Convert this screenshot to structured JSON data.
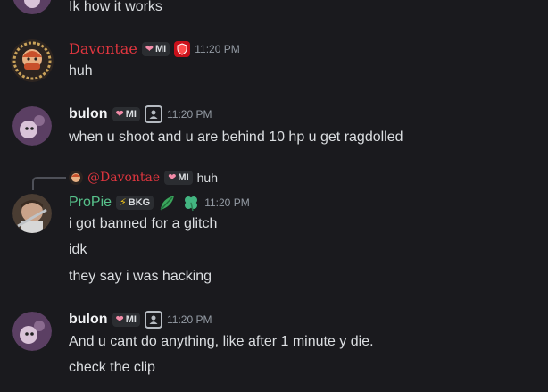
{
  "messages": [
    {
      "text": "Ik how it works"
    },
    {
      "author": "Davontae",
      "tag": "MI",
      "time": "11:20 PM",
      "lines": [
        "huh"
      ]
    },
    {
      "author": "bulon",
      "tag": "MI",
      "time": "11:20 PM",
      "lines": [
        "when u shoot and u are  behind 10 hp u get ragdolled"
      ]
    },
    {
      "reply_to": {
        "author": "@Davontae",
        "tag": "MI",
        "text": "huh"
      },
      "author": "ProPie",
      "tag": "BKG",
      "tag_prefix": "⚡",
      "time": "11:20 PM",
      "lines": [
        "i got banned for a glitch",
        "idk",
        "they say i was hacking"
      ]
    },
    {
      "author": "bulon",
      "tag": "MI",
      "time": "11:20 PM",
      "lines": [
        "And u cant do anything, like after 1 minute y die.",
        "check the clip"
      ]
    }
  ],
  "colors": {
    "background": "#1a1a1e",
    "davontae_name": "#e0363f",
    "bulon_name": "#f2f3f5",
    "propie_name": "#57c28b",
    "text": "#dbdee1",
    "timestamp": "#949ba4"
  },
  "icons": [
    "heart-icon",
    "shield-icon",
    "person-icon",
    "lightning-icon",
    "leaf-icon",
    "clover-icon"
  ]
}
